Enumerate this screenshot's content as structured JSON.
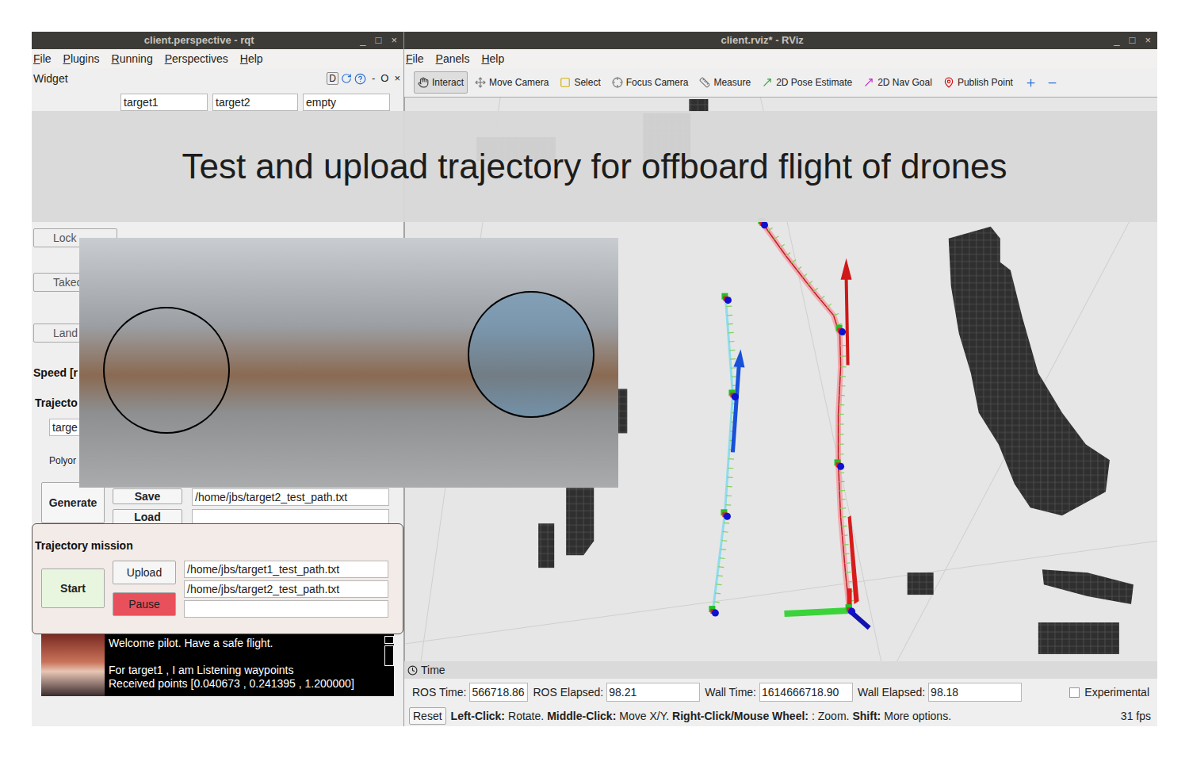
{
  "banner": {
    "text": "Test and upload trajectory for offboard flight of drones"
  },
  "rqt": {
    "title": "client.perspective - rqt",
    "window_controls": [
      "_",
      "□",
      "×"
    ],
    "menu": [
      "File",
      "Plugins",
      "Running",
      "Perspectives",
      "Help"
    ],
    "widget": {
      "title": "Widget",
      "controls": [
        "D",
        "-",
        "O",
        "×"
      ]
    },
    "targets": [
      "target1",
      "target2",
      "empty"
    ],
    "commands": [
      "Lock",
      "Takeo",
      "Land"
    ],
    "labels": {
      "speed": "Speed [r",
      "trajectory": "Trajecto",
      "polynomial": "Polyor"
    },
    "target_field": "targe",
    "generate": "Generate",
    "save": {
      "label": "Save",
      "path": "/home/jbs/target2_test_path.txt"
    },
    "load": {
      "label": "Load",
      "path": ""
    },
    "mission": {
      "title": "Trajectory mission",
      "start": "Start",
      "upload": "Upload",
      "pause": "Pause",
      "paths": [
        "/home/jbs/target1_test_path.txt",
        "/home/jbs/target2_test_path.txt",
        ""
      ]
    },
    "console": {
      "groups": [
        [
          "Welcome pilot. Have a safe flight."
        ],
        [
          "For target1 , I am Listening waypoints",
          "Received points [0.040673 , 0.241395 , 1.200000]"
        ]
      ]
    }
  },
  "rviz": {
    "title": "client.rviz* - RViz",
    "window_controls": [
      "_",
      "□",
      "×"
    ],
    "menu": [
      "File",
      "Panels",
      "Help"
    ],
    "tools": [
      {
        "label": "Interact",
        "selected": true
      },
      {
        "label": "Move Camera",
        "selected": false
      },
      {
        "label": "Select",
        "selected": false
      },
      {
        "label": "Focus Camera",
        "selected": false
      },
      {
        "label": "Measure",
        "selected": false
      },
      {
        "label": "2D Pose Estimate",
        "selected": false
      },
      {
        "label": "2D Nav Goal",
        "selected": false
      },
      {
        "label": "Publish Point",
        "selected": false
      }
    ],
    "time_panel": {
      "title": "Time",
      "fields": [
        {
          "label": "ROS Time:",
          "value": "566718.86"
        },
        {
          "label": "ROS Elapsed:",
          "value": "98.21"
        },
        {
          "label": "Wall Time:",
          "value": "1614666718.90"
        },
        {
          "label": "Wall Elapsed:",
          "value": "98.18"
        }
      ],
      "experimental": {
        "label": "Experimental",
        "checked": false
      }
    },
    "status": {
      "reset": "Reset",
      "hints": [
        {
          "key": "Left-Click:",
          "text": "Rotate."
        },
        {
          "key": "Middle-Click:",
          "text": "Move X/Y."
        },
        {
          "key": "Right-Click/Mouse Wheel:",
          "text": ": Zoom."
        },
        {
          "key": "Shift:",
          "text": "More options."
        }
      ],
      "fps": "31 fps"
    }
  }
}
